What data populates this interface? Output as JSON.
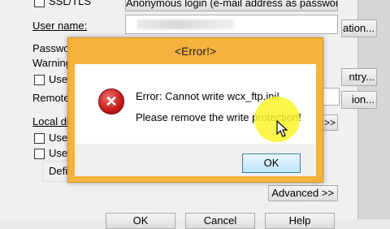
{
  "background": {
    "ssl_label": "SSL/TLS",
    "anon_login_button": "Anonymous login (e-mail address as password)",
    "user_name_label": "User name:",
    "password_label": "Passwo",
    "warning_label": "Warning:",
    "use_m_label": "Use n",
    "remote_label": "Remote f",
    "local_dir_label": "Local dir",
    "use_p_label": "Use p",
    "use_f_label": "Use f",
    "defin_label": "Defin",
    "right_btn_ation": "ation...",
    "right_btn_ntry": "ntry...",
    "right_btn_ion": "ion...",
    "arrows_button": ">>",
    "advanced_button": "Advanced >>",
    "bottom_ok": "OK",
    "bottom_cancel": "Cancel",
    "bottom_help": "Help"
  },
  "dialog": {
    "title": "<Error!>",
    "line1": "Error: Cannot write wcx_ftp.ini!",
    "line2": "Please remove the write protection!",
    "ok_label": "OK"
  },
  "colors": {
    "dialog_frame": "#f4b33e",
    "highlight": "#faf528",
    "error_icon": "#c41818"
  }
}
